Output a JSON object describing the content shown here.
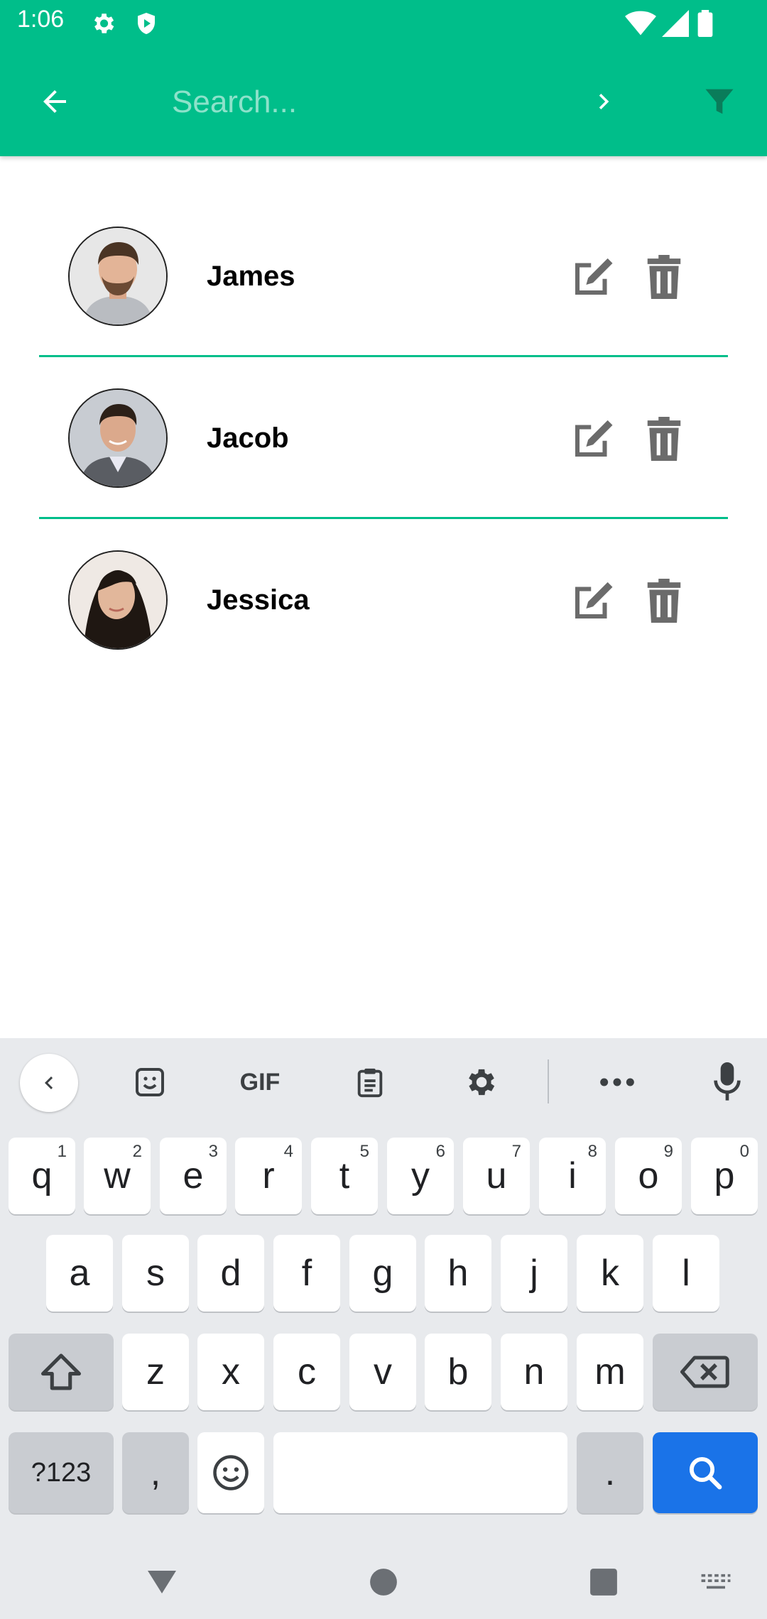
{
  "status_bar": {
    "time": "1:06",
    "icons": [
      "settings-icon",
      "shield-icon",
      "wifi-icon",
      "signal-icon",
      "battery-icon"
    ]
  },
  "toolbar": {
    "search_placeholder": "Search...",
    "search_value": "",
    "icons": [
      "back-arrow-icon",
      "chevron-right-icon",
      "filter-icon"
    ]
  },
  "contacts": [
    {
      "name": "James",
      "avatar": "avatar-james"
    },
    {
      "name": "Jacob",
      "avatar": "avatar-jacob"
    },
    {
      "name": "Jessica",
      "avatar": "avatar-jessica"
    }
  ],
  "keyboard": {
    "suggestion_icons": [
      "chevron-left-icon",
      "sticker-icon",
      "gif-icon",
      "clipboard-icon",
      "settings-icon",
      "more-icon",
      "mic-icon"
    ],
    "gif_label": "GIF",
    "row1": [
      [
        "q",
        "1"
      ],
      [
        "w",
        "2"
      ],
      [
        "e",
        "3"
      ],
      [
        "r",
        "4"
      ],
      [
        "t",
        "5"
      ],
      [
        "y",
        "6"
      ],
      [
        "u",
        "7"
      ],
      [
        "i",
        "8"
      ],
      [
        "o",
        "9"
      ],
      [
        "p",
        "0"
      ]
    ],
    "row2": [
      "a",
      "s",
      "d",
      "f",
      "g",
      "h",
      "j",
      "k",
      "l"
    ],
    "row3": [
      "z",
      "x",
      "c",
      "v",
      "b",
      "n",
      "m"
    ],
    "row4": {
      "symbols": "?123",
      "comma": ",",
      "period": "."
    }
  },
  "colors": {
    "accent": "#00BE8A",
    "icon_gray": "#6b6b6b",
    "keyboard_bg": "#E8EAED",
    "search_key": "#1A73E8"
  }
}
